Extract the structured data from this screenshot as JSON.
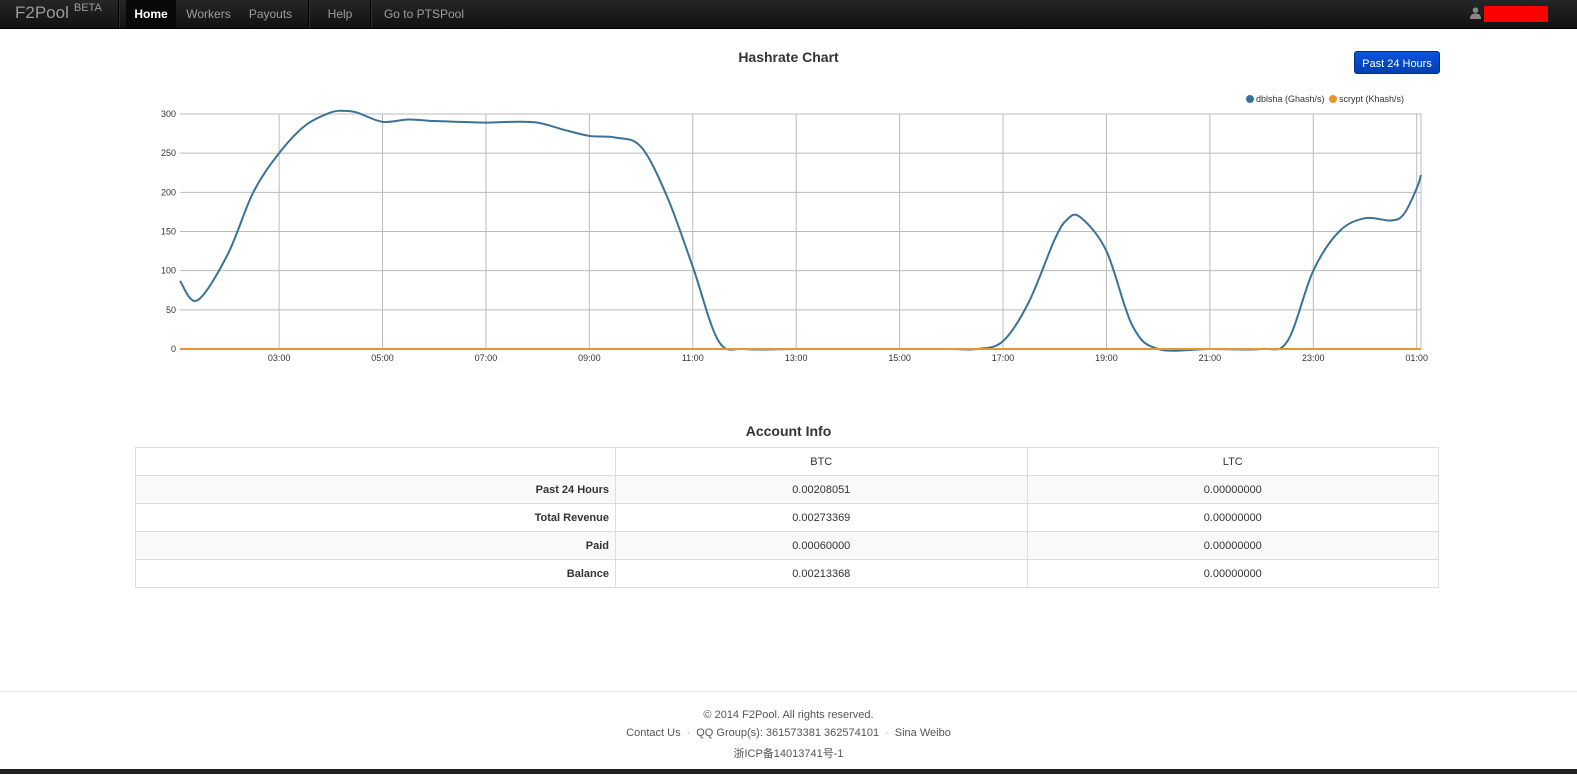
{
  "navbar": {
    "brand": "F2Pool",
    "brand_badge": "BETA",
    "items": [
      {
        "label": "Home",
        "active": true
      },
      {
        "label": "Workers"
      },
      {
        "label": "Payouts"
      },
      {
        "label": "Help"
      },
      {
        "label": "Go to PTSPool"
      }
    ],
    "user_icon": "user-icon"
  },
  "chart": {
    "title": "Hashrate Chart",
    "range_button": "Past 24 Hours"
  },
  "chart_data": {
    "type": "line",
    "x_ticks": [
      "03:00",
      "05:00",
      "07:00",
      "09:00",
      "11:00",
      "13:00",
      "15:00",
      "17:00",
      "19:00",
      "21:00",
      "23:00",
      "01:00"
    ],
    "xlim": [
      "01:05",
      "01:05"
    ],
    "ylim": [
      0,
      300
    ],
    "y_ticks": [
      0,
      50,
      100,
      150,
      200,
      250,
      300
    ],
    "grid": true,
    "legend": "top-right",
    "series": [
      {
        "name": "dblsha (Ghash/s)",
        "color": "#3a7397",
        "x": [
          "01:05",
          "01:25",
          "02:00",
          "02:30",
          "03:00",
          "03:30",
          "04:00",
          "04:15",
          "04:30",
          "05:00",
          "05:30",
          "06:00",
          "06:30",
          "07:00",
          "07:30",
          "08:00",
          "08:30",
          "09:00",
          "09:30",
          "10:00",
          "10:30",
          "11:00",
          "11:30",
          "12:00",
          "13:00",
          "14:00",
          "15:00",
          "16:00",
          "16:30",
          "17:00",
          "17:30",
          "18:00",
          "18:15",
          "18:30",
          "19:00",
          "19:30",
          "20:00",
          "21:00",
          "22:00",
          "22:30",
          "23:00",
          "23:30",
          "24:00",
          "24:30",
          "24:45",
          "25:00",
          "25:05"
        ],
        "values": [
          87,
          62,
          120,
          200,
          250,
          285,
          302,
          304,
          302,
          290,
          293,
          291,
          290,
          289,
          290,
          289,
          280,
          272,
          270,
          258,
          195,
          105,
          10,
          0,
          0,
          0,
          0,
          0,
          0,
          10,
          60,
          140,
          166,
          168,
          125,
          30,
          0,
          0,
          0,
          10,
          100,
          150,
          167,
          164,
          172,
          205,
          222
        ]
      },
      {
        "name": "scrypt (Khash/s)",
        "color": "#e8942f",
        "x": [
          "01:05",
          "25:05"
        ],
        "values": [
          0,
          0
        ]
      }
    ]
  },
  "account": {
    "title": "Account Info",
    "columns": [
      "",
      "BTC",
      "LTC"
    ],
    "rows": [
      {
        "label": "Past 24 Hours",
        "btc": "0.00208051",
        "ltc": "0.00000000"
      },
      {
        "label": "Total Revenue",
        "btc": "0.00273369",
        "ltc": "0.00000000"
      },
      {
        "label": "Paid",
        "btc": "0.00060000",
        "ltc": "0.00000000"
      },
      {
        "label": "Balance",
        "btc": "0.00213368",
        "ltc": "0.00000000"
      }
    ]
  },
  "footer": {
    "copyright": "© 2014 F2Pool. All rights reserved.",
    "contact": "Contact Us",
    "qq": "QQ Group(s): 361573381 362574101",
    "weibo": "Sina Weibo",
    "icp": "浙ICP备14013741号-1"
  }
}
